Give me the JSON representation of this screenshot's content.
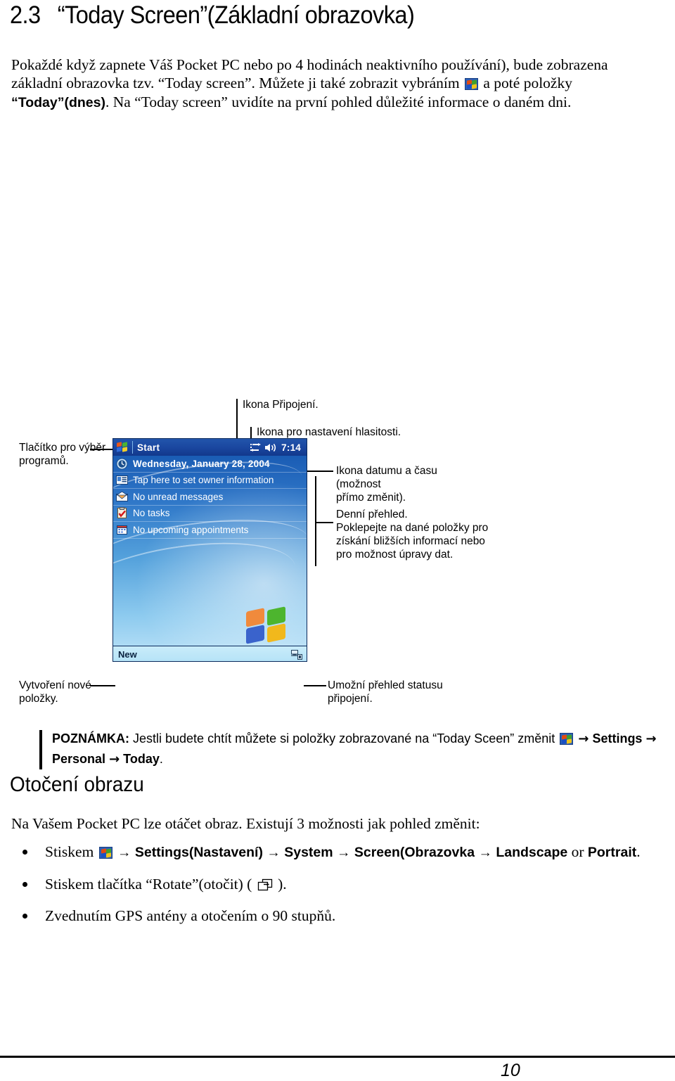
{
  "document": {
    "section_number": "2.3",
    "section_title": "“Today Screen”(Základní obrazovka)",
    "intro_paragraph_part1": "Pokaždé když zapnete Váš Pocket PC nebo po 4 hodinách neaktivního používání), bude zobrazena základní obrazovka tzv. “Today screen”. Můžete ji také zobrazit vybráním ",
    "intro_paragraph_part2": " a poté položky ",
    "intro_bold_today": "“Today”",
    "intro_bold_dnes": "(dnes)",
    "intro_paragraph_part3": ". Na “Today screen” uvidíte na první pohled důležité informace o daném dni.",
    "subheading": "Otočení obrazu",
    "rotate_intro": "Na Vašem Pocket PC lze otáčet obraz. Existují 3 možnosti jak pohled změnit:",
    "page_number": "10"
  },
  "note": {
    "label": "POZNÁMKA:",
    "text_before_icon": " Jestli budete chtít můžete si položky zobrazované na “Today Sceen” změnit ",
    "arrow": "→",
    "item_settings": "Settings",
    "item_personal": "Personal",
    "item_today": "Today",
    "trailing": "."
  },
  "bullets": [
    {
      "prefix": "Stiskem ",
      "arrow": "→",
      "chain": [
        "Settings(Nastavení)",
        "System",
        "Screen(Obrazovka",
        "Landscape"
      ],
      "or_word": "or",
      "last": "Portrait",
      "suffix": "."
    },
    {
      "text_before": "Stiskem tlačítka “Rotate”(otočit) ( ",
      "text_after": " )."
    },
    {
      "text": "Zvednutím GPS antény a otočením o 90 stupňů."
    }
  ],
  "figure": {
    "callouts": {
      "connection_icon": "Ikona Připojení.",
      "volume_icon": "Ikona pro nastavení hlasitosti.",
      "start_button": "Tlačítko pro výběr\nprogramů.",
      "datetime_icon": "Ikona datumu a času (možnost\npřímo změnit).",
      "daily_overview": "Denní přehled.\nPoklepejte na dané položky pro\nzískání bližších informací nebo\npro možnost úpravy dat.",
      "new_item": "Vytvoření nové\npoložky.",
      "connection_status": "Umožní přehled statusu\npřipojení."
    }
  },
  "pda": {
    "titlebar": {
      "start_label": "Start",
      "clock": "7:14",
      "connection_icon": "connection-icon",
      "volume_icon": "volume-icon",
      "start_flag_icon": "windows-flag-icon"
    },
    "rows": [
      {
        "icon": "clock-icon",
        "label": "Wednesday, January 28, 2004"
      },
      {
        "icon": "owner-card-icon",
        "label": "Tap here to set owner information"
      },
      {
        "icon": "messages-icon",
        "label": "No unread messages"
      },
      {
        "icon": "tasks-icon",
        "label": "No tasks"
      },
      {
        "icon": "calendar-icon",
        "label": "No upcoming appointments"
      }
    ],
    "command_bar": {
      "new_label": "New",
      "connection_status_icon": "network-connection-icon"
    },
    "wallpaper_logo_icon": "windows-logo-icon"
  },
  "colors": {
    "titlebar_blue": "#1a47a0",
    "desktop_blue": "#55a2dc",
    "command_bar": "#b5e3f7",
    "text": "#000000"
  }
}
